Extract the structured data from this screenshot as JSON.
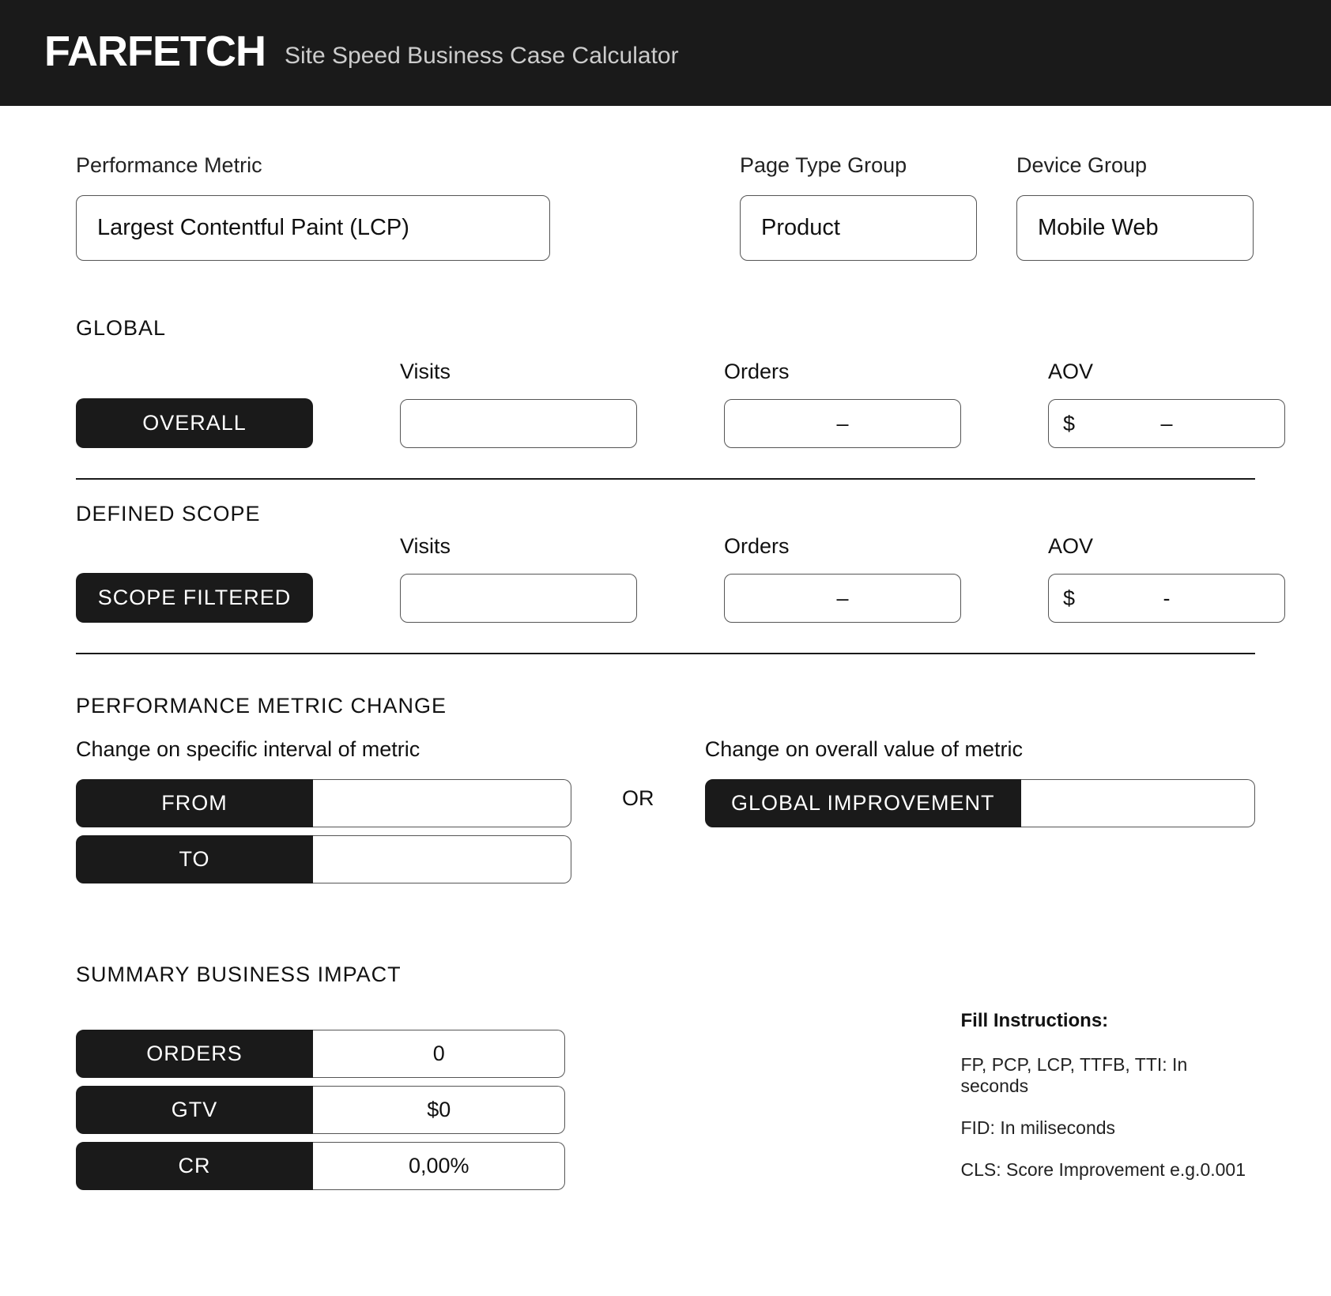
{
  "header": {
    "logo": "FARFETCH",
    "subtitle": "Site Speed Business Case Calculator"
  },
  "filters": {
    "performance_metric": {
      "label": "Performance Metric",
      "value": "Largest Contentful Paint (LCP)"
    },
    "page_type_group": {
      "label": "Page Type Group",
      "value": "Product"
    },
    "device_group": {
      "label": "Device Group",
      "value": "Mobile Web"
    }
  },
  "global": {
    "heading": "GLOBAL",
    "row_label": "OVERALL",
    "columns": {
      "visits": "Visits",
      "orders": "Orders",
      "aov": "AOV"
    },
    "values": {
      "visits": "",
      "orders": "–",
      "aov_prefix": "$",
      "aov": "–"
    }
  },
  "scope": {
    "heading": "DEFINED SCOPE",
    "row_label": "SCOPE FILTERED",
    "columns": {
      "visits": "Visits",
      "orders": "Orders",
      "aov": "AOV"
    },
    "values": {
      "visits": "",
      "orders": "–",
      "aov_prefix": "$",
      "aov": "-"
    }
  },
  "change": {
    "heading": "PERFORMANCE METRIC CHANGE",
    "interval_label": "Change on specific interval of metric",
    "from_label": "FROM",
    "to_label": "TO",
    "from_value": "",
    "to_value": "",
    "or": "OR",
    "overall_label": "Change on overall value of metric",
    "global_improvement_label": "GLOBAL IMPROVEMENT",
    "global_improvement_value": ""
  },
  "summary": {
    "heading": "SUMMARY BUSINESS IMPACT",
    "rows": {
      "orders": {
        "label": "ORDERS",
        "value": "0"
      },
      "gtv": {
        "label": "GTV",
        "value": "$0"
      },
      "cr": {
        "label": "CR",
        "value": "0,00%"
      }
    }
  },
  "instructions": {
    "title": "Fill Instructions:",
    "lines": [
      "FP, PCP, LCP, TTFB, TTI: In seconds",
      "FID: In miliseconds",
      "CLS: Score Improvement e.g.0.001"
    ]
  }
}
